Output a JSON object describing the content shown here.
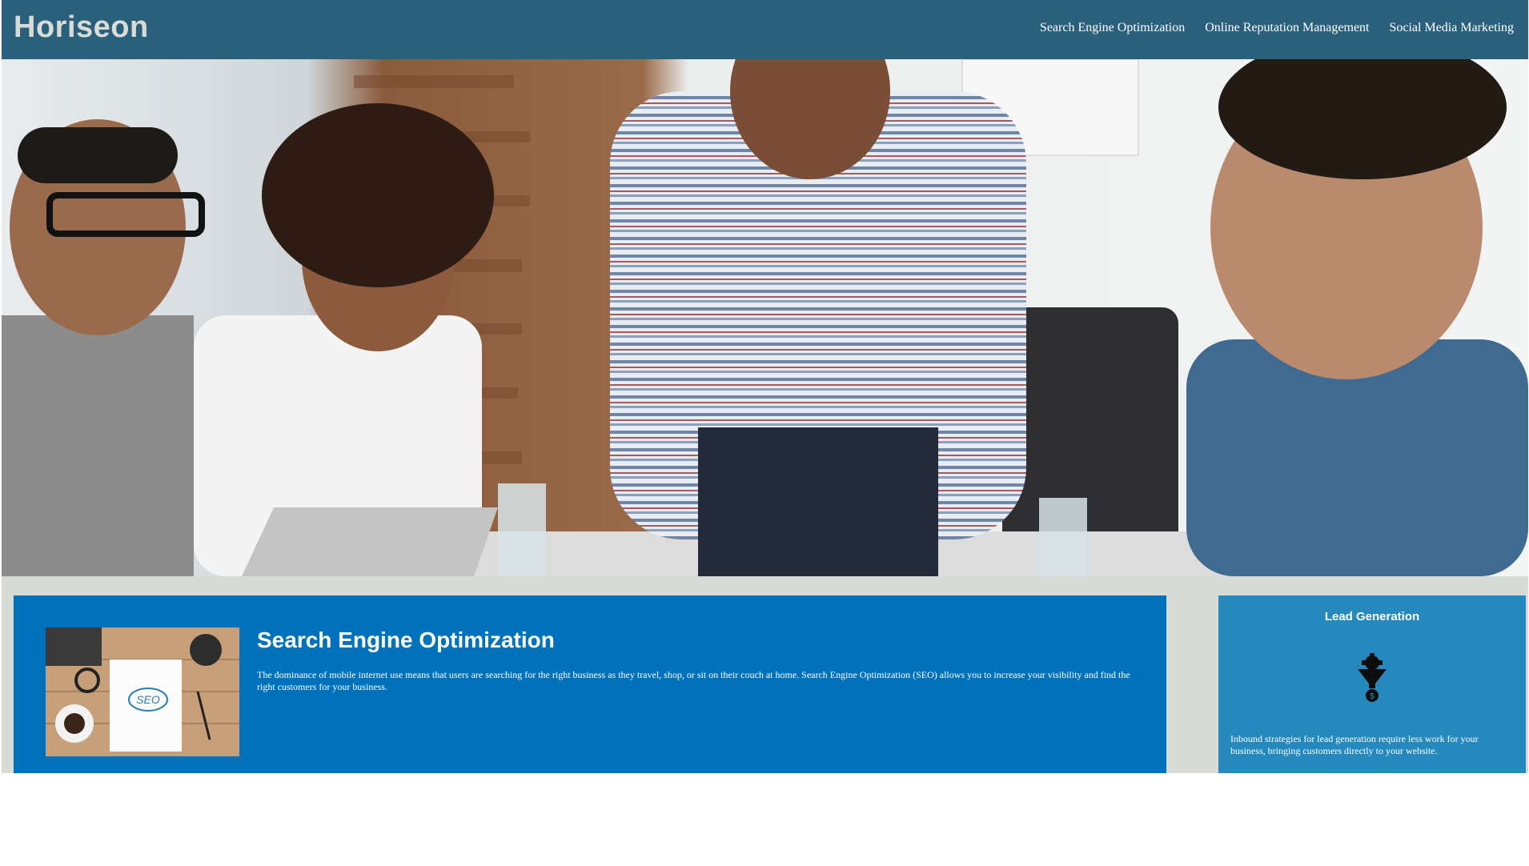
{
  "header": {
    "logo": "Horiseon",
    "nav": [
      {
        "label": "Search Engine Optimization"
      },
      {
        "label": "Online Reputation Management"
      },
      {
        "label": "Social Media Marketing"
      }
    ]
  },
  "hero": {
    "icon": "hero-team-meeting-photo"
  },
  "main": {
    "section": {
      "title": "Search Engine Optimization",
      "text": "The dominance of mobile internet use means that users are searching for the right business as they travel, shop, or sit on their couch at home. Search Engine Optimization (SEO) allows you to increase your visibility and find the right customers for your business.",
      "image_icon": "seo-desk-photo",
      "image_text": "SEO"
    }
  },
  "sidebar": {
    "title": "Lead Generation",
    "icon": "lead-generation-funnel-icon",
    "text": "Inbound strategies for lead generation require less work for your business, bringing customers directly to your website."
  },
  "colors": {
    "header_bg": "#2a607c",
    "logo": "#d9dcd6",
    "page_bg": "#d9dcd6",
    "content_bg": "#0072bb",
    "sidebar_bg": "#2589bd"
  }
}
